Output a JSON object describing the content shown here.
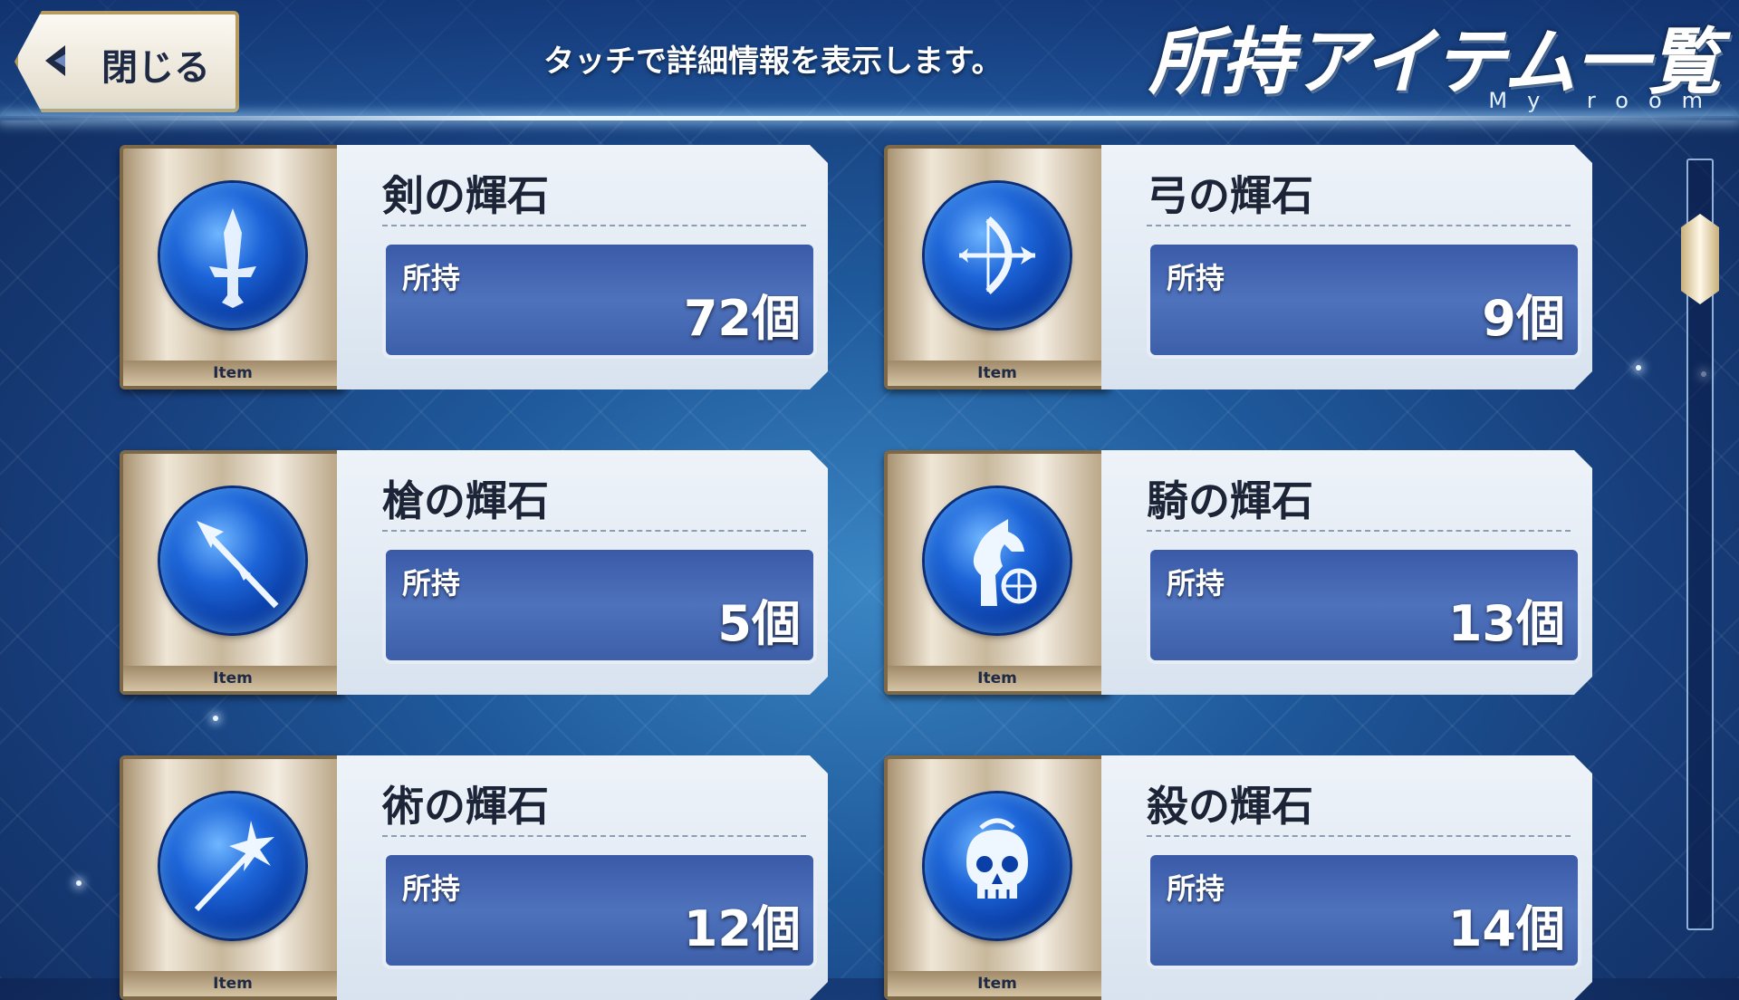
{
  "header": {
    "close_label": "閉じる",
    "hint": "タッチで詳細情報を表示します。",
    "title": "所持アイテム一覧",
    "subtitle": "My room"
  },
  "item_tag": "Item",
  "own_label": "所持",
  "items": [
    {
      "name": "剣の輝石",
      "count": "72個",
      "icon": "saber-sword-icon"
    },
    {
      "name": "弓の輝石",
      "count": "9個",
      "icon": "archer-bow-icon"
    },
    {
      "name": "槍の輝石",
      "count": "5個",
      "icon": "lancer-spear-icon"
    },
    {
      "name": "騎の輝石",
      "count": "13個",
      "icon": "rider-horse-icon"
    },
    {
      "name": "術の輝石",
      "count": "12個",
      "icon": "caster-staff-icon"
    },
    {
      "name": "殺の輝石",
      "count": "14個",
      "icon": "assassin-skull-icon"
    }
  ],
  "colors": {
    "orb_blue": "#1c64d8",
    "count_box": "#4a6cb6",
    "panel": "#e6edf5",
    "frame_gold": "#b79b5e"
  }
}
